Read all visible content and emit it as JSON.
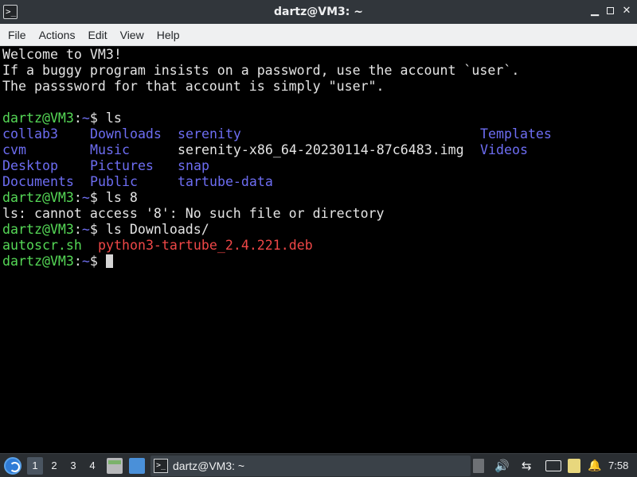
{
  "window": {
    "title": "dartz@VM3: ~",
    "app_icon": "terminal-icon",
    "icon_glyph": ">_",
    "controls": [
      "minimize-icon",
      "maximize-icon",
      "close-icon"
    ]
  },
  "menu": [
    "File",
    "Actions",
    "Edit",
    "View",
    "Help"
  ],
  "terminal": {
    "colors": {
      "background": "#000000",
      "text": "#e4e4e4",
      "user": "#55d856",
      "path": "#6f6ff0",
      "directory": "#6d6df2",
      "executable": "#55d856",
      "package": "#ef4747"
    },
    "welcome": [
      "Welcome to VM3!",
      "If a buggy program insists on a password, use the account `user`.",
      "The passsword for that account is simply \"user\"."
    ],
    "prompt_user": "dartz@VM3",
    "prompt_sep": ":",
    "prompt_path": "~",
    "prompt_end": "$ ",
    "cmd1": "ls",
    "ls_rows": [
      [
        "collab3",
        "Downloads",
        "serenity",
        "Templates"
      ],
      [
        "cvm",
        "Music",
        "serenity-x86_64-20230114-87c6483.img",
        "Videos"
      ],
      [
        "Desktop",
        "Pictures",
        "snap",
        ""
      ],
      [
        "Documents",
        "Public",
        "tartube-data",
        ""
      ]
    ],
    "cmd2": "ls 8",
    "error": "ls: cannot access '8': No such file or directory",
    "cmd3": "ls Downloads/",
    "downloads": {
      "script": "autoscr.sh",
      "package": "python3-tartube_2.4.221.deb"
    }
  },
  "taskbar": {
    "workspaces": [
      "1",
      "2",
      "3",
      "4"
    ],
    "active_workspace": "1",
    "task_label": "dartz@VM3: ~",
    "clock": "7:58",
    "tray_glyphs": {
      "volume": "🔊",
      "network": "⇆",
      "notify": "🔔"
    }
  }
}
